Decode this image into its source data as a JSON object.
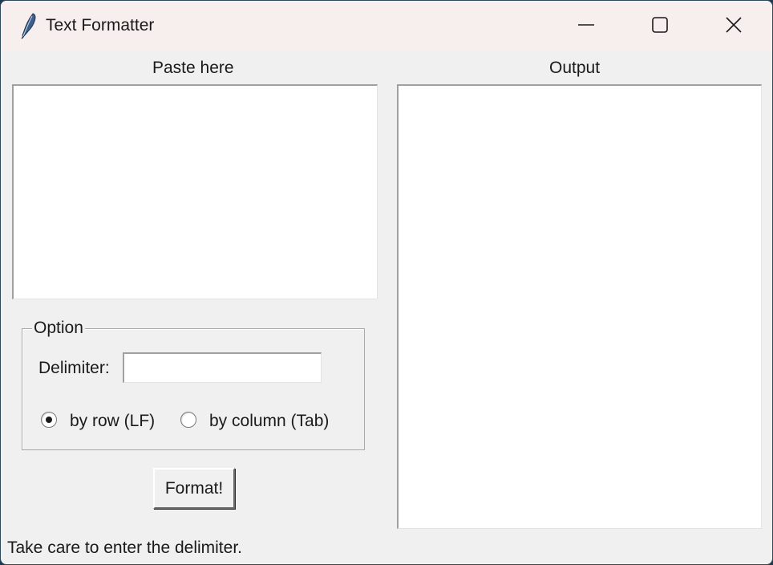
{
  "window": {
    "title": "Text Formatter",
    "icon": "feather-icon"
  },
  "input_panel": {
    "label": "Paste here",
    "value": ""
  },
  "output_panel": {
    "label": "Output",
    "value": ""
  },
  "options": {
    "legend": "Option",
    "delimiter_label": "Delimiter:",
    "delimiter_value": "",
    "radios": [
      {
        "label": "by row (LF)",
        "checked": true
      },
      {
        "label": "by column (Tab)",
        "checked": false
      }
    ]
  },
  "format_button": {
    "label": "Format!"
  },
  "status": {
    "text": "Take care to enter the delimiter."
  }
}
